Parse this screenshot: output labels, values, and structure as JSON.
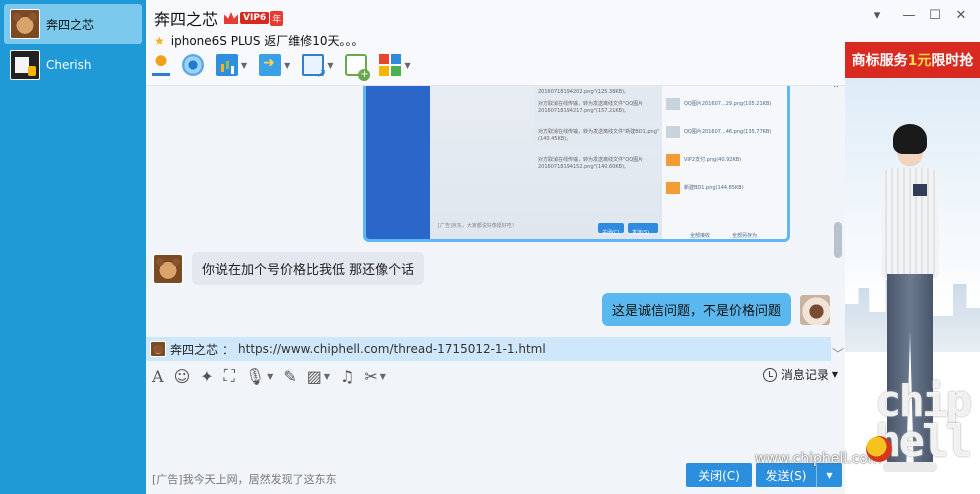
{
  "contacts": [
    {
      "name": "奔四之芯",
      "active": true
    },
    {
      "name": "Cherish",
      "active": false
    }
  ],
  "header": {
    "title": "奔四之芯",
    "vip_label": "VIP6",
    "year_label": "年",
    "signature": "iphone6S PLUS 返厂维修10天。。。"
  },
  "toolbar_icons": [
    "microphone-icon",
    "webcam-icon",
    "screen-share-icon",
    "file-transfer-icon",
    "remote-desktop-icon",
    "create-note-icon",
    "apps-icon"
  ],
  "window_controls": [
    "▾",
    "—",
    "☐",
    "✕"
  ],
  "ad": {
    "banner_prefix": "商标服务",
    "banner_highlight": "1元",
    "banner_suffix": "限时抢",
    "logo_text": "chip hell"
  },
  "screenshot": {
    "rows": [
      "2016071819420​2.png\"(125.38KB)。",
      "对方取消在线传输，转为发送离线文件\"QQ图片20160718194217.png\"(157.21KB)。",
      "对方取消在线传输，转为发送离线文件\"新建BD1.png\"(140.45KB)。",
      "对方取消在线传输，转为发送离线文件\"QQ图片20160718194152.png\"(140.60KB)。"
    ],
    "ad_line": "[广告]京东，大家都说好像挺好吃！",
    "btn_close": "关闭(C)",
    "btn_send": "发送(S)",
    "files": [
      "QQ图片201607...29.png(105.21KB)",
      "QQ图片201607...46.png(135.77KB)",
      "VIP2支付.png(40.92KB)",
      "新建BD1.png(144.85KB)"
    ],
    "footer_left": "全部接收",
    "footer_right": "全部另存为"
  },
  "messages": [
    {
      "side": "left",
      "text": "你说在加个号价格比我低 那还像个话"
    },
    {
      "side": "right",
      "text": "这是诚信问题，不是价格问题"
    }
  ],
  "quote": {
    "name": "奔四之芯",
    "separator": "：",
    "url": "https://www.chiphell.com/thread-1715012-1-1.html"
  },
  "input_toolbar_icons": [
    "font-icon",
    "emoji-icon",
    "magic-wand-icon",
    "screenshot-icon",
    "voice-message-icon",
    "edit-icon",
    "image-icon",
    "music-icon",
    "scissors-icon"
  ],
  "history_label": "消息记录",
  "footer": {
    "ad_text": "[广告]我今天上网，居然发现了这东东",
    "close_label": "关闭(C)",
    "send_label": "发送(S)",
    "watermark": "www.chiphell.com"
  }
}
